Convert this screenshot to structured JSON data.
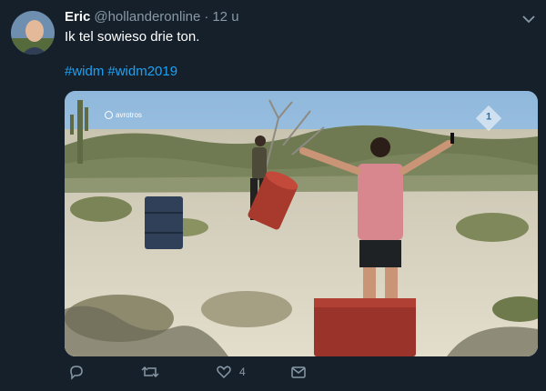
{
  "tweet": {
    "author_name": "Eric",
    "author_handle": "@hollanderonline",
    "separator": "·",
    "timestamp": "12 u",
    "text": "Ik tel sowieso drie ton.",
    "hashtags": [
      "#widm",
      "#widm2019"
    ],
    "media": {
      "broadcaster_logo": "avrotros",
      "channel_logo": "1"
    },
    "actions": {
      "reply_icon": "reply-icon",
      "retweet_icon": "retweet-icon",
      "like_icon": "heart-icon",
      "like_count": "4",
      "share_icon": "envelope-icon"
    }
  },
  "colors": {
    "background": "#15202b",
    "link": "#1da1f2",
    "muted": "#8899a6"
  }
}
